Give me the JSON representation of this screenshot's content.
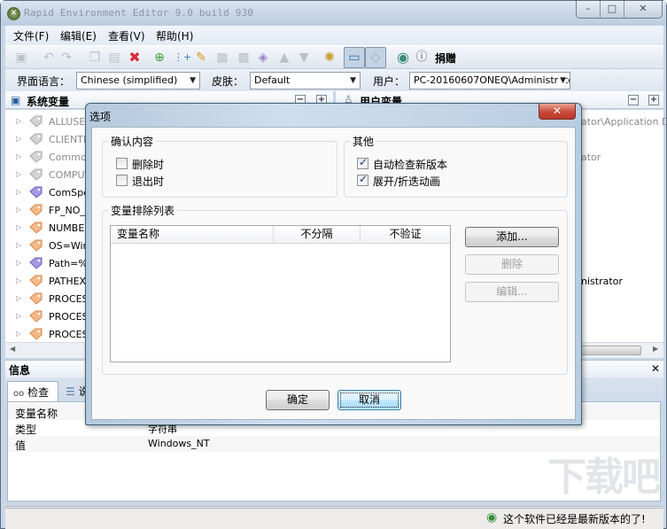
{
  "window": {
    "title": "Rapid Environment Editor 9.0 build 930",
    "minimize": "–",
    "maximize": "□",
    "close": "✕"
  },
  "menu": {
    "items": [
      {
        "label": "文件(F)"
      },
      {
        "label": "编辑(E)"
      },
      {
        "label": "查看(V)"
      },
      {
        "label": "帮助(H)"
      }
    ]
  },
  "toolbar": {
    "donate_label": "捐赠",
    "icons": [
      "save-icon",
      "undo-icon",
      "redo-icon",
      "copy-icon",
      "paste-icon",
      "delete-icon",
      "add-variable-icon",
      "add-value-icon",
      "edit-icon",
      "cut-icon",
      "clone-icon",
      "tag-icon",
      "move-up-icon",
      "move-down-icon",
      "settings-icon",
      "info-view-icon",
      "tag-view-icon",
      "update-icon",
      "help-icon"
    ]
  },
  "options_bar": {
    "language_label": "界面语言：",
    "language_value": "Chinese (simplified)",
    "skin_label": "皮肤：",
    "skin_value": "Default",
    "user_label": "用户：",
    "user_value": "PC-20160607ONEQ\\Administratc"
  },
  "system_panel": {
    "title": "系统变量",
    "items": [
      {
        "text": "ALLUSERS",
        "state": "inactive"
      },
      {
        "text": "CLIENTNA",
        "state": "inactive"
      },
      {
        "text": "CommonP",
        "state": "inactive"
      },
      {
        "text": "COMPUTE",
        "state": "inactive"
      },
      {
        "text": "ComSpec=",
        "state": "expandable"
      },
      {
        "text": "FP_NO_H",
        "state": "normal"
      },
      {
        "text": "NUMBER_",
        "state": "normal"
      },
      {
        "text": "OS=Wind",
        "state": "normal"
      },
      {
        "text": "Path=%S",
        "state": "expandable"
      },
      {
        "text": "PATHEXT=",
        "state": "normal"
      },
      {
        "text": "PROCESS",
        "state": "normal"
      },
      {
        "text": "PROCESS",
        "state": "normal"
      },
      {
        "text": "PROCESS",
        "state": "normal"
      }
    ]
  },
  "user_panel": {
    "title": "用户变量",
    "partial_rows": [
      {
        "text": "ator\\Application Da",
        "grey": true
      },
      {
        "text": "ator",
        "grey": true
      },
      {
        "text": "nistrator",
        "grey": false
      }
    ]
  },
  "info_panel": {
    "title": "信息",
    "close": "✕",
    "tabs": [
      {
        "label": "检查"
      },
      {
        "label": "说"
      }
    ],
    "rows": [
      {
        "key": "变量名称",
        "value": ""
      },
      {
        "key": "类型",
        "value": "字符串"
      },
      {
        "key": "值",
        "value": "Windows_NT"
      }
    ]
  },
  "status": {
    "message": "这个软件已经是最新版本的了!"
  },
  "dialog": {
    "title": "选项",
    "close": "✕",
    "confirm_group": {
      "title": "确认内容",
      "options": [
        {
          "label": "删除时",
          "checked": false
        },
        {
          "label": "退出时",
          "checked": false
        }
      ]
    },
    "other_group": {
      "title": "其他",
      "options": [
        {
          "label": "自动检查新版本",
          "checked": true
        },
        {
          "label": "展开/折迭动画",
          "checked": true
        }
      ]
    },
    "exclusion_group": {
      "title": "变量排除列表",
      "columns": [
        "变量名称",
        "不分隔",
        "不验证"
      ],
      "rows": []
    },
    "buttons": {
      "add": "添加...",
      "remove": "删除",
      "edit": "编辑...",
      "ok": "确定",
      "cancel": "取消"
    }
  },
  "colors": {
    "frame": "#c9d6e6",
    "dialog_close": "#c8493a",
    "focus": "#3c7fb1"
  }
}
